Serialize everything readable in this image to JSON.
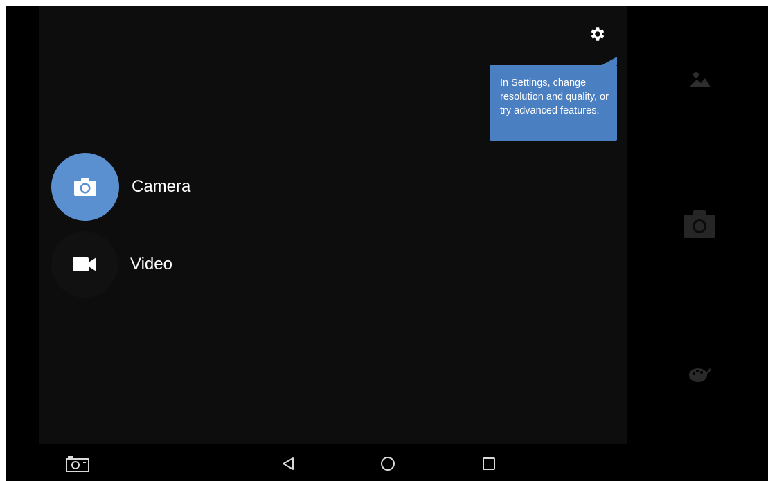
{
  "tooltip": {
    "text": "In Settings, change resolution and quality, or try advanced features."
  },
  "modes": {
    "camera_label": "Camera",
    "video_label": "Video",
    "selected": "Camera"
  },
  "colors": {
    "accent": "#5a8fd0",
    "tooltip_bg": "#4a7fc1",
    "panel_bg": "#0d0d0d"
  },
  "icons": {
    "settings": "gear-icon",
    "camera_mode": "camera-icon",
    "video_mode": "video-camera-icon",
    "gallery": "image-landscape-icon",
    "shutter": "camera-shutter-icon",
    "filters": "palette-icon",
    "nav_screenshot": "screenshot-icon",
    "nav_back": "back-triangle-icon",
    "nav_home": "home-circle-icon",
    "nav_recents": "recents-square-icon"
  }
}
